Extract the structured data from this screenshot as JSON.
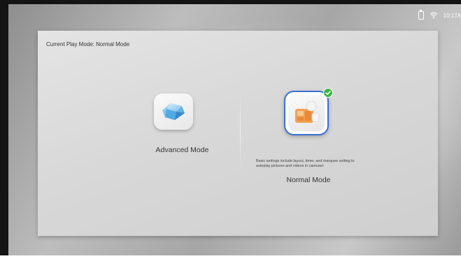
{
  "status_bar": {
    "time": "10:17A"
  },
  "panel": {
    "current_mode_text": "Current Play Mode: Normal Mode"
  },
  "modes": {
    "advanced": {
      "label": "Advanced Mode",
      "icon": "advanced-mode-gem-icon",
      "selected": false
    },
    "normal": {
      "label": "Normal Mode",
      "icon": "normal-mode-media-icon",
      "selected": true,
      "description": "Basic settings include layout, timer, and marquee setting to autoplay pictures and videos in carousel."
    }
  },
  "colors": {
    "selection_border": "#3b6fd4",
    "check_badge": "#3fb54a",
    "media_icon_orange": "#f0a050"
  }
}
